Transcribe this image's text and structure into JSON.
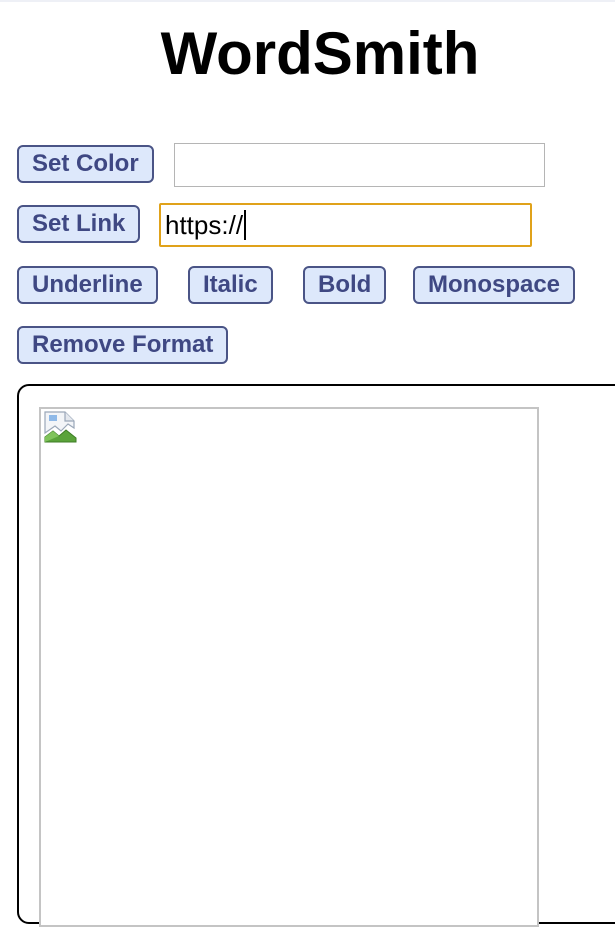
{
  "app": {
    "title": "WordSmith"
  },
  "toolbar": {
    "set_color_label": "Set Color",
    "color_value": "",
    "set_link_label": "Set Link",
    "link_value": "https://",
    "underline_label": "Underline",
    "italic_label": "Italic",
    "bold_label": "Bold",
    "monospace_label": "Monospace",
    "remove_format_label": "Remove Format"
  },
  "editor": {
    "image_icon": "broken-image-icon"
  },
  "colors": {
    "button_bg": "#dde8fb",
    "button_border": "#4a5486",
    "button_text": "#3f4883",
    "focus_border": "#e0a21a"
  }
}
